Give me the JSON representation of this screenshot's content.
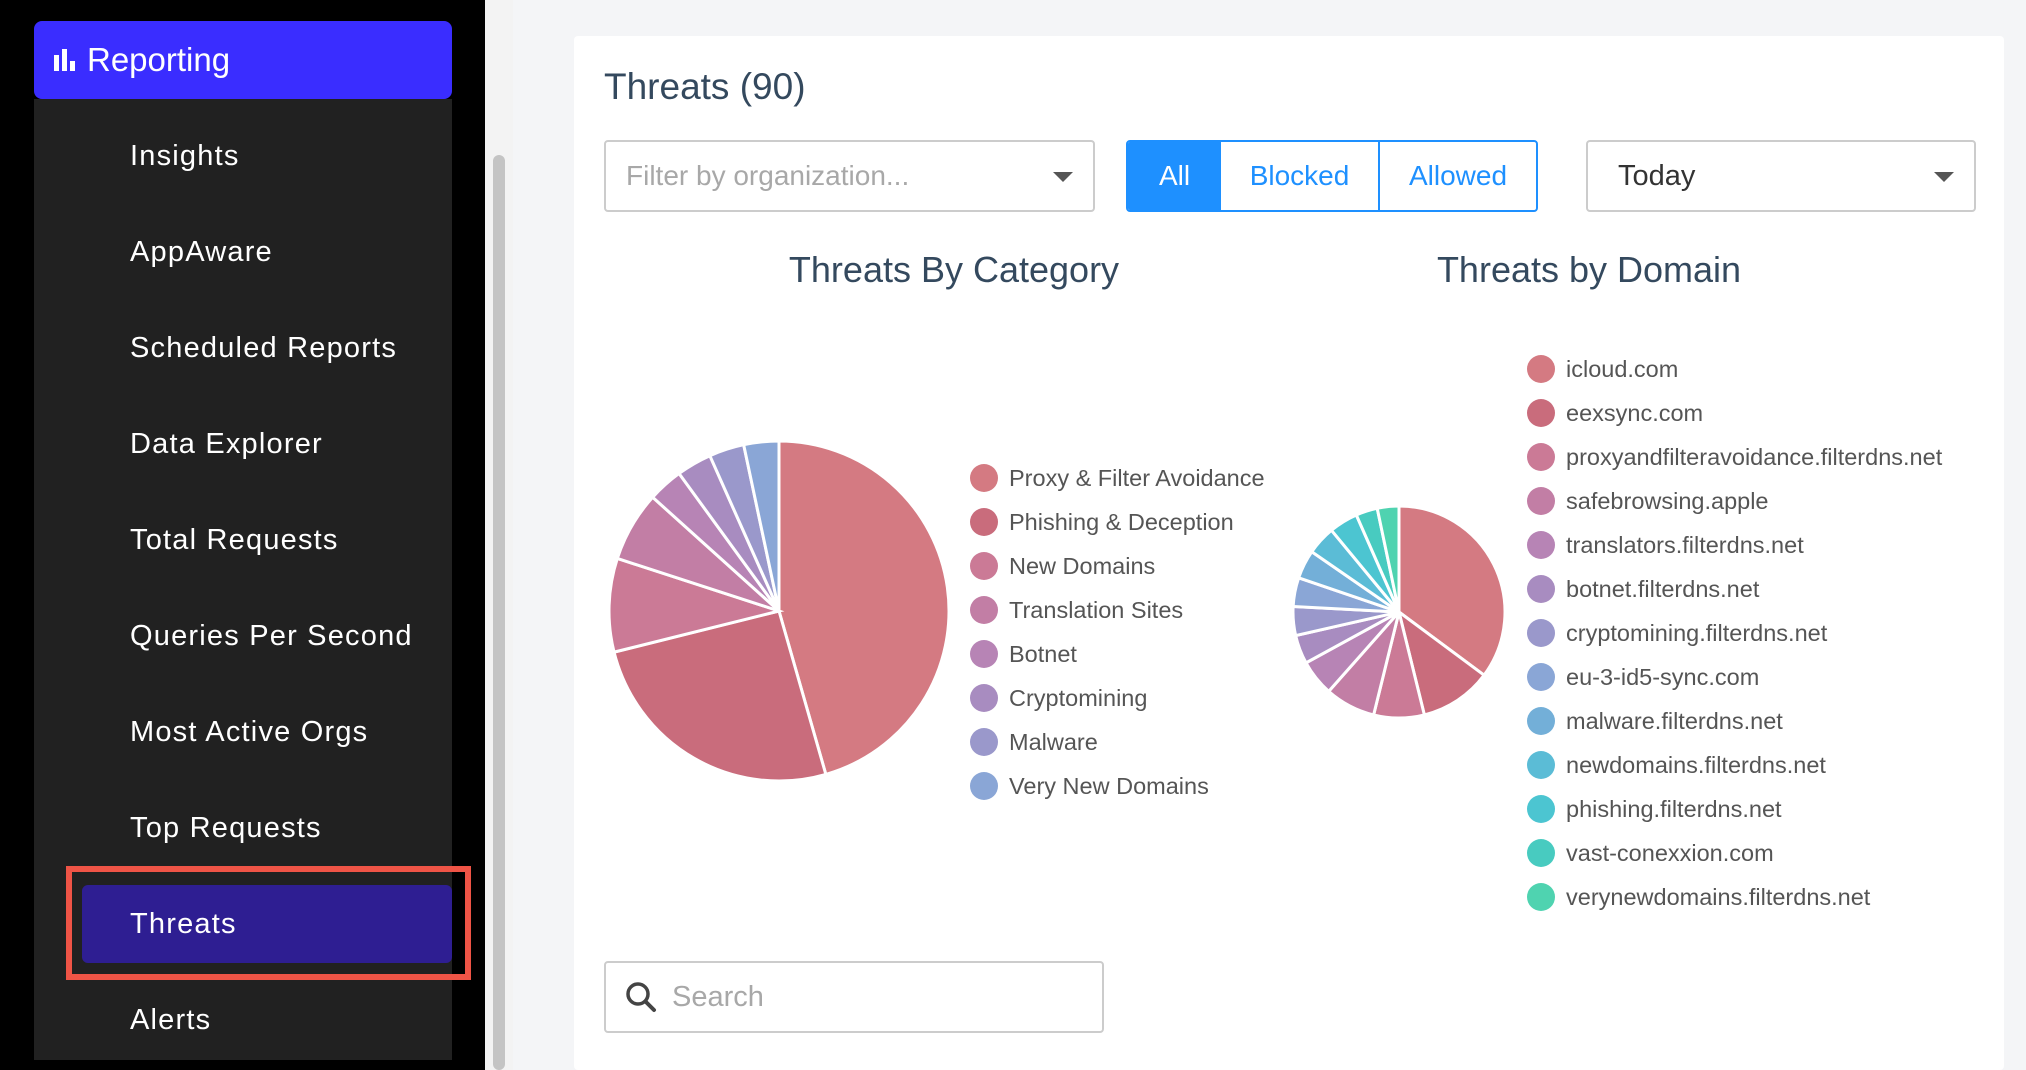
{
  "sidebar": {
    "reporting_label": "Reporting",
    "items": [
      {
        "label": "Insights"
      },
      {
        "label": "AppAware"
      },
      {
        "label": "Scheduled Reports"
      },
      {
        "label": "Data Explorer"
      },
      {
        "label": "Total Requests"
      },
      {
        "label": "Queries Per Second"
      },
      {
        "label": "Most Active Orgs"
      },
      {
        "label": "Top Requests"
      },
      {
        "label": "Threats",
        "active": true
      },
      {
        "label": "Alerts"
      }
    ]
  },
  "main": {
    "title": "Threats (90)",
    "org_filter": {
      "placeholder": "Filter by organization..."
    },
    "segments": {
      "all": "All",
      "blocked": "Blocked",
      "allowed": "Allowed",
      "selected": "All"
    },
    "date_range": "Today",
    "search": {
      "placeholder": "Search"
    }
  },
  "chart_data": [
    {
      "type": "pie",
      "title": "Threats By Category",
      "legend_position": "right",
      "categories": [
        "Proxy & Filter Avoidance",
        "Phishing & Deception",
        "New Domains",
        "Translation Sites",
        "Botnet",
        "Cryptomining",
        "Malware",
        "Very New Domains"
      ],
      "values": [
        41,
        23,
        8,
        6,
        3,
        3,
        3,
        3
      ],
      "colors": [
        "#d47a82",
        "#c96c7c",
        "#cb7a96",
        "#c27ea5",
        "#b784b5",
        "#a88cc0",
        "#9a98cb",
        "#8aa6d6"
      ]
    },
    {
      "type": "pie",
      "title": "Threats by Domain",
      "legend_position": "top-right",
      "categories": [
        "icloud.com",
        "eexsync.com",
        "proxyandfilteravoidance.filterdns.net",
        "safebrowsing.apple",
        "translators.filterdns.net",
        "botnet.filterdns.net",
        "cryptomining.filterdns.net",
        "eu-3-id5-sync.com",
        "malware.filterdns.net",
        "newdomains.filterdns.net",
        "phishing.filterdns.net",
        "vast-conexxion.com",
        "verynewdomains.filterdns.net"
      ],
      "values": [
        32,
        10,
        7,
        7,
        5,
        4,
        4,
        4,
        4,
        4,
        4,
        3,
        3
      ],
      "colors": [
        "#d47a82",
        "#c96c7c",
        "#cb7a96",
        "#c27ea5",
        "#b784b5",
        "#a88cc0",
        "#9a98cb",
        "#8aa6d6",
        "#73afd8",
        "#5bbcd6",
        "#4cc5d1",
        "#48cbc0",
        "#4fd3b0"
      ]
    }
  ]
}
